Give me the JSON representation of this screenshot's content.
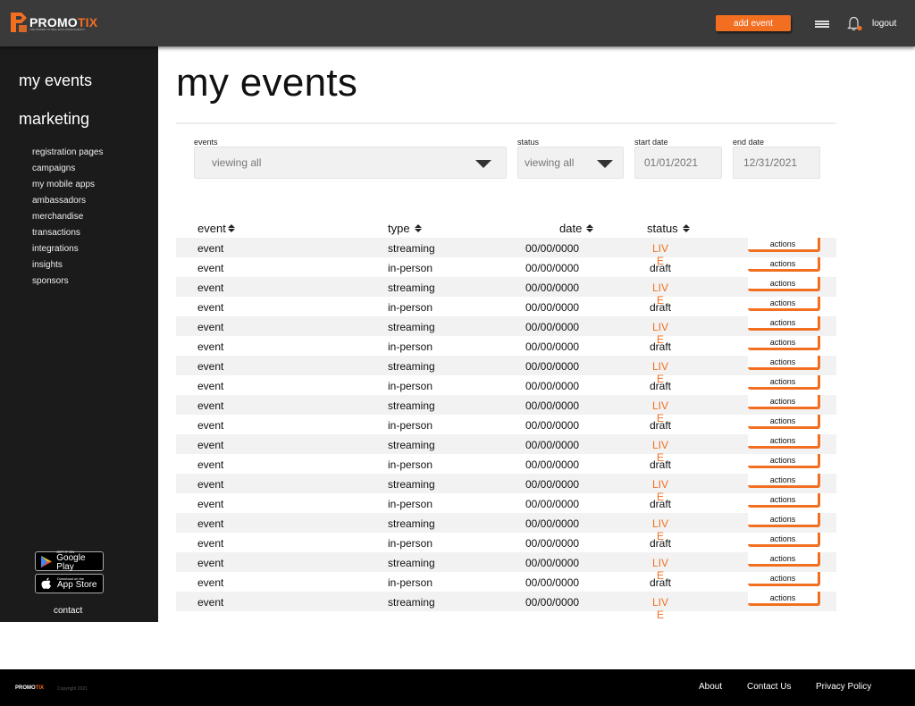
{
  "header": {
    "logo_left": "PROMO",
    "logo_right": "TIX",
    "tagline": "THE POWER TO SELL EXCLUSIVE EVENTS",
    "add_event_label": "add event",
    "logout_label": "logout"
  },
  "sidebar": {
    "main_items": [
      "my events",
      "marketing"
    ],
    "sub_items": [
      "registration pages",
      "campaigns",
      "my mobile apps",
      "ambassadors",
      "merchandise",
      "transactions",
      "integrations",
      "insights",
      "sponsors"
    ],
    "google_play": {
      "small": "GET IT ON",
      "big": "Google Play"
    },
    "app_store": {
      "small": "Download on the",
      "big": "App Store"
    },
    "contact_label": "contact"
  },
  "main": {
    "title": "my events",
    "filters": {
      "events_label": "events",
      "events_value": "viewing all",
      "status_label": "status",
      "status_value": "viewing all",
      "start_date_label": "start date",
      "start_date_value": "01/01/2021",
      "end_date_label": "end date",
      "end_date_value": "12/31/2021"
    },
    "columns": [
      "event",
      "type",
      "date",
      "status"
    ],
    "actions_label": "actions",
    "rows": [
      {
        "event": "event",
        "type": "streaming",
        "date": "00/00/0000",
        "status": "LIVE"
      },
      {
        "event": "event",
        "type": "in-person",
        "date": "00/00/0000",
        "status": "draft"
      },
      {
        "event": "event",
        "type": "streaming",
        "date": "00/00/0000",
        "status": "LIVE"
      },
      {
        "event": "event",
        "type": "in-person",
        "date": "00/00/0000",
        "status": "draft"
      },
      {
        "event": "event",
        "type": "streaming",
        "date": "00/00/0000",
        "status": "LIVE"
      },
      {
        "event": "event",
        "type": "in-person",
        "date": "00/00/0000",
        "status": "draft"
      },
      {
        "event": "event",
        "type": "streaming",
        "date": "00/00/0000",
        "status": "LIVE"
      },
      {
        "event": "event",
        "type": "in-person",
        "date": "00/00/0000",
        "status": "draft"
      },
      {
        "event": "event",
        "type": "streaming",
        "date": "00/00/0000",
        "status": "LIVE"
      },
      {
        "event": "event",
        "type": "in-person",
        "date": "00/00/0000",
        "status": "draft"
      },
      {
        "event": "event",
        "type": "streaming",
        "date": "00/00/0000",
        "status": "LIVE"
      },
      {
        "event": "event",
        "type": "in-person",
        "date": "00/00/0000",
        "status": "draft"
      },
      {
        "event": "event",
        "type": "streaming",
        "date": "00/00/0000",
        "status": "LIVE"
      },
      {
        "event": "event",
        "type": "in-person",
        "date": "00/00/0000",
        "status": "draft"
      },
      {
        "event": "event",
        "type": "streaming",
        "date": "00/00/0000",
        "status": "LIVE"
      },
      {
        "event": "event",
        "type": "in-person",
        "date": "00/00/0000",
        "status": "draft"
      },
      {
        "event": "event",
        "type": "streaming",
        "date": "00/00/0000",
        "status": "LIVE"
      },
      {
        "event": "event",
        "type": "in-person",
        "date": "00/00/0000",
        "status": "draft"
      },
      {
        "event": "event",
        "type": "streaming",
        "date": "00/00/0000",
        "status": "LIVE"
      }
    ]
  },
  "footer": {
    "logo_left": "PROMO",
    "logo_right": "TIX",
    "copyright": "Copyright 2021",
    "links": [
      "About",
      "Contact Us",
      "Privacy Policy"
    ]
  },
  "colors": {
    "accent": "#f26f21",
    "header_bg": "#3a3a3a",
    "sidebar_bg": "#1b1b1b",
    "footer_bg": "#000000"
  }
}
